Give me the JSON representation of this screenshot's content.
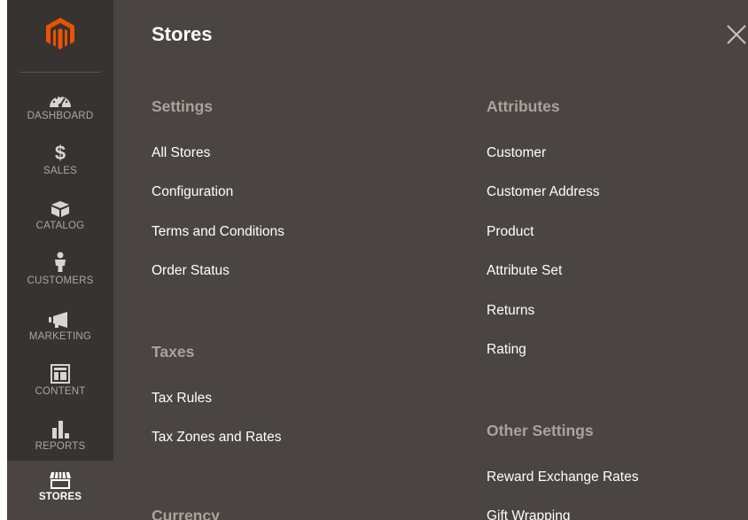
{
  "sidebar": {
    "logo_icon": "magento-logo-icon",
    "items": [
      {
        "label": "DASHBOARD",
        "icon": "speedometer-icon"
      },
      {
        "label": "SALES",
        "icon": "dollar-icon",
        "glyph": "$"
      },
      {
        "label": "CATALOG",
        "icon": "box-icon"
      },
      {
        "label": "CUSTOMERS",
        "icon": "person-icon"
      },
      {
        "label": "MARKETING",
        "icon": "megaphone-icon"
      },
      {
        "label": "CONTENT",
        "icon": "layout-icon"
      },
      {
        "label": "REPORTS",
        "icon": "bar-chart-icon"
      },
      {
        "label": "STORES",
        "icon": "storefront-icon"
      }
    ],
    "active_item": "STORES"
  },
  "panel": {
    "title": "Stores",
    "close_icon": "close-icon",
    "columns": [
      {
        "sections": [
          {
            "title": "Settings",
            "links": [
              "All Stores",
              "Configuration",
              "Terms and Conditions",
              "Order Status"
            ]
          },
          {
            "title": "Taxes",
            "links": [
              "Tax Rules",
              "Tax Zones and Rates"
            ]
          },
          {
            "title": "Currency",
            "links": []
          }
        ]
      },
      {
        "sections": [
          {
            "title": "Attributes",
            "links": [
              "Customer",
              "Customer Address",
              "Product",
              "Attribute Set",
              "Returns",
              "Rating"
            ]
          },
          {
            "title": "Other Settings",
            "links": [
              "Reward Exchange Rates",
              "Gift Wrapping"
            ]
          }
        ]
      }
    ]
  },
  "colors": {
    "sidebar_bg": "#373330",
    "panel_bg": "#4a4542",
    "logo_orange": "#eb5202",
    "section_title": "#a9a39b",
    "link_text": "#ffffff"
  }
}
